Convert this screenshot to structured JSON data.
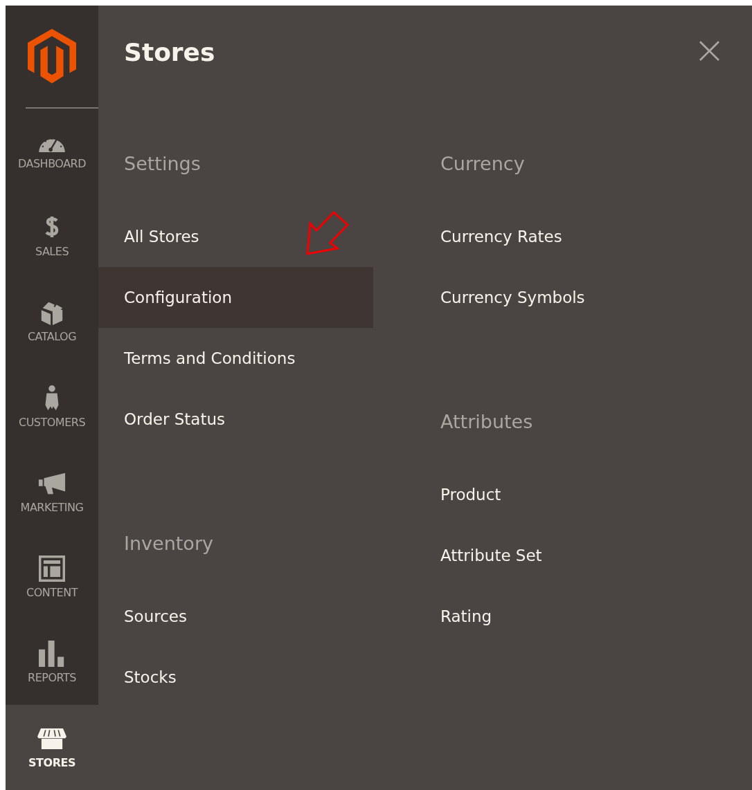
{
  "sidebar": {
    "items": [
      {
        "label": "DASHBOARD",
        "selected": false
      },
      {
        "label": "SALES",
        "selected": false
      },
      {
        "label": "CATALOG",
        "selected": false
      },
      {
        "label": "CUSTOMERS",
        "selected": false
      },
      {
        "label": "MARKETING",
        "selected": false
      },
      {
        "label": "CONTENT",
        "selected": false
      },
      {
        "label": "REPORTS",
        "selected": false
      },
      {
        "label": "STORES",
        "selected": true
      }
    ]
  },
  "panel": {
    "title": "Stores",
    "close": "×",
    "columns": [
      {
        "groups": [
          {
            "heading": "Settings",
            "items": [
              {
                "label": "All Stores",
                "selected": false
              },
              {
                "label": "Configuration",
                "selected": true
              },
              {
                "label": "Terms and Conditions",
                "selected": false
              },
              {
                "label": "Order Status",
                "selected": false
              }
            ]
          },
          {
            "heading": "Inventory",
            "items": [
              {
                "label": "Sources",
                "selected": false
              },
              {
                "label": "Stocks",
                "selected": false
              }
            ]
          }
        ]
      },
      {
        "groups": [
          {
            "heading": "Currency",
            "items": [
              {
                "label": "Currency Rates",
                "selected": false
              },
              {
                "label": "Currency Symbols",
                "selected": false
              }
            ]
          },
          {
            "heading": "Attributes",
            "items": [
              {
                "label": "Product",
                "selected": false
              },
              {
                "label": "Attribute Set",
                "selected": false
              },
              {
                "label": "Rating",
                "selected": false
              }
            ]
          }
        ]
      }
    ]
  }
}
